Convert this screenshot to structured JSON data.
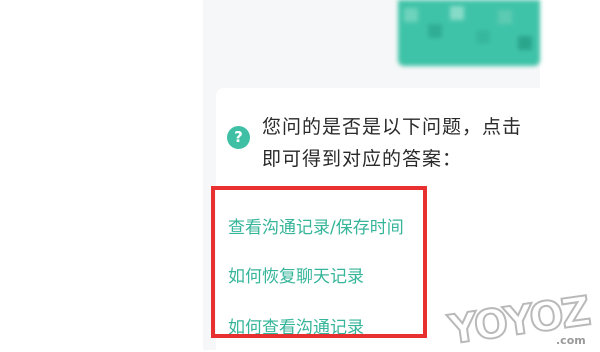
{
  "prompt": {
    "line1": "您问的是否是以下问题，点击",
    "line2": "即可得到对应的答案："
  },
  "icons": {
    "help": "?"
  },
  "questions": [
    {
      "label": "查看沟通记录/保存时间"
    },
    {
      "label": "如何恢复聊天记录"
    },
    {
      "label": "如何查看沟通记录"
    }
  ],
  "watermark": {
    "text": "YOYOZ",
    "suffix": ".com"
  },
  "colors": {
    "accent": "#36b59a",
    "highlight": "#e83030",
    "bubble": "#3fc3a8"
  }
}
